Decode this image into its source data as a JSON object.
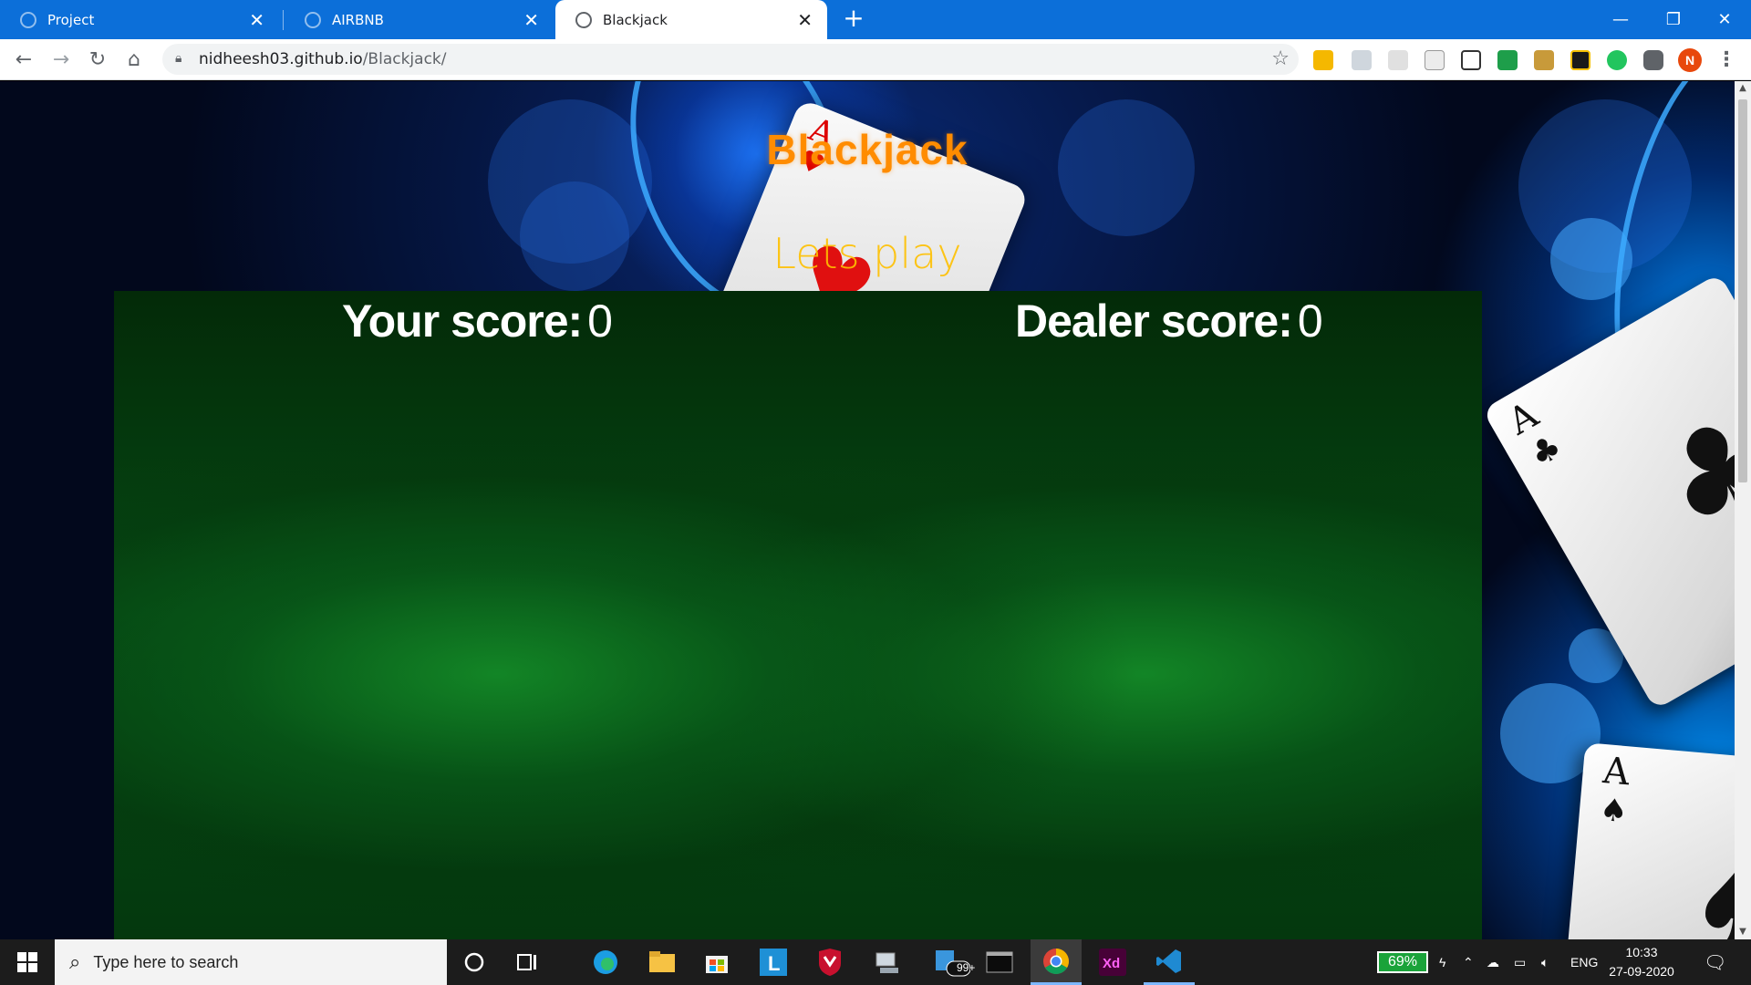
{
  "browser": {
    "tabs": [
      {
        "title": "Project",
        "active": false
      },
      {
        "title": "AIRBNB",
        "active": false
      },
      {
        "title": "Blackjack",
        "active": true
      }
    ],
    "url_host": "nidheesh03.github.io",
    "url_path": "/Blackjack/",
    "profile_initial": "N"
  },
  "page": {
    "title": "Blackjack",
    "subtitle": "Lets play",
    "your_score_label": "Your score:",
    "your_score_value": "0",
    "dealer_score_label": "Dealer score:",
    "dealer_score_value": "0",
    "hero_card": {
      "rank": "A",
      "suit": "♥"
    },
    "side_cards": [
      {
        "rank": "A",
        "suit": "♣"
      },
      {
        "rank": "A",
        "suit": "♠"
      }
    ]
  },
  "taskbar": {
    "search_placeholder": "Type here to search",
    "mail_badge": "99+",
    "battery": "69%",
    "language": "ENG",
    "time": "10:33",
    "date": "27-09-2020"
  },
  "colors": {
    "tab_strip": "#0c6fd9",
    "title": "#ff8c00",
    "subtitle": "#ffc000",
    "felt": "#0a6a1c",
    "battery": "#1aa33a"
  }
}
